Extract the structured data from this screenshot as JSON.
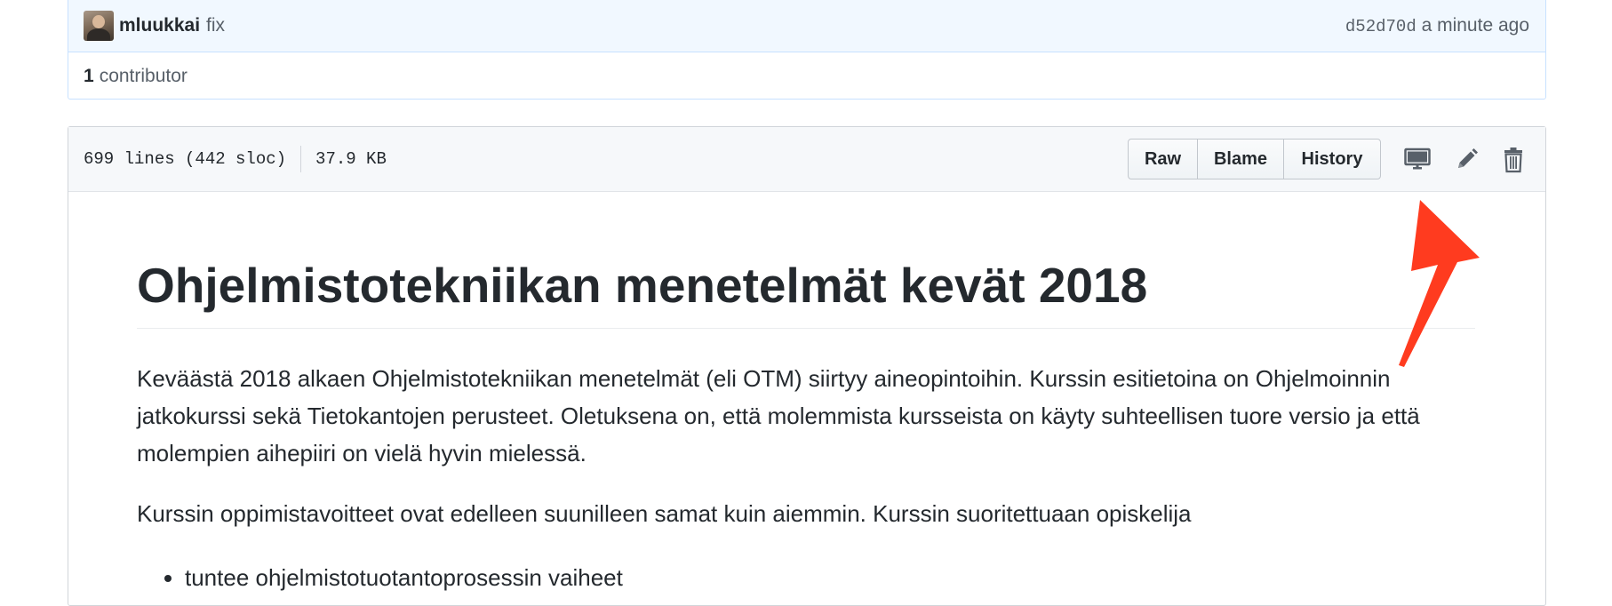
{
  "commit": {
    "author": "mluukkai",
    "message": "fix",
    "sha": "d52d70d",
    "time": "a minute ago"
  },
  "contributors": {
    "count": "1",
    "label": "contributor"
  },
  "file": {
    "lines": "699 lines (442 sloc)",
    "size": "37.9 KB",
    "buttons": {
      "raw": "Raw",
      "blame": "Blame",
      "history": "History"
    },
    "icons": {
      "desktop": "desktop-icon",
      "edit": "pencil-icon",
      "delete": "trash-icon"
    }
  },
  "readme": {
    "title": "Ohjelmistotekniikan menetelmät kevät 2018",
    "paragraph1": "Keväästä 2018 alkaen Ohjelmistotekniikan menetelmät (eli OTM) siirtyy aineopintoihin. Kurssin esitietoina on Ohjelmoinnin jatkokurssi sekä Tietokantojen perusteet. Oletuksena on, että molemmista kursseista on käyty suhteellisen tuore versio ja että molempien aihepiiri on vielä hyvin mielessä.",
    "paragraph2": "Kurssin oppimistavoitteet ovat edelleen suunilleen samat kuin aiemmin. Kurssin suoritettuaan opiskelija",
    "list": [
      "tuntee ohjelmistotuotantoprosessin vaiheet"
    ]
  },
  "colors": {
    "annotation_arrow": "#ff3b1f",
    "commit_background": "#f1f8ff",
    "header_background": "#f6f8fa"
  }
}
